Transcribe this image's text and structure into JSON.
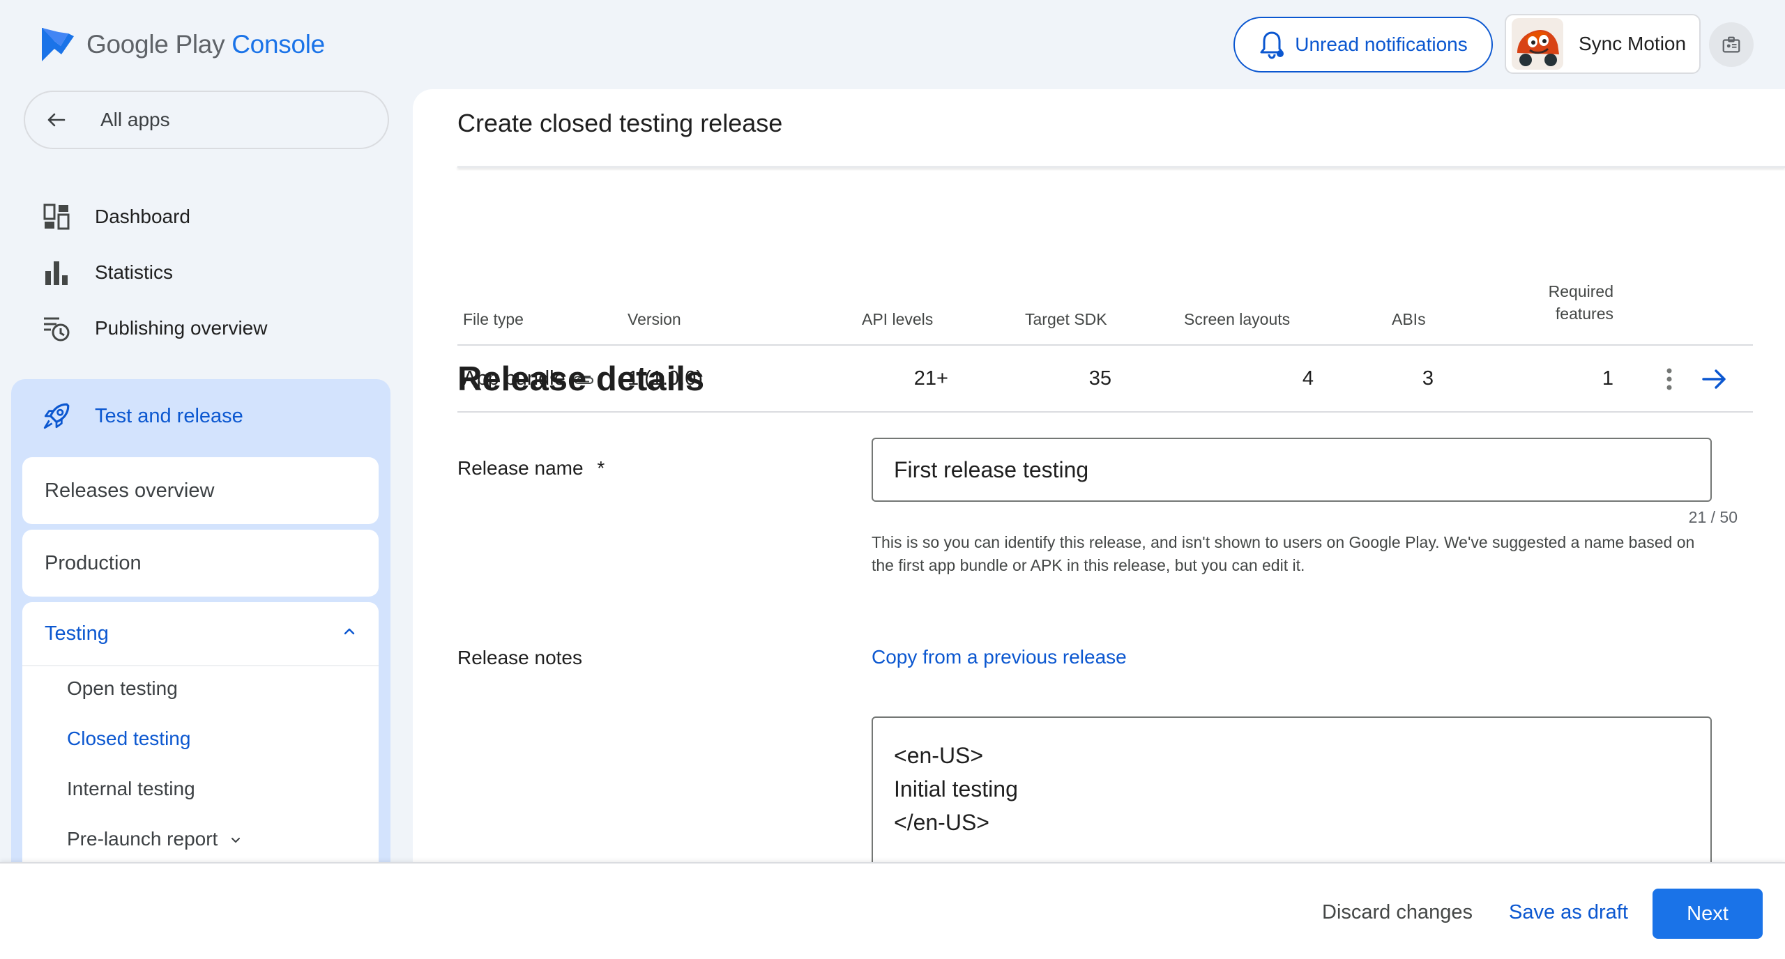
{
  "header": {
    "logo_google_play": "Google Play",
    "logo_console": "Console",
    "notifications_label": "Unread notifications",
    "account_name": "Sync Motion"
  },
  "sidebar": {
    "all_apps": "All apps",
    "items": [
      {
        "label": "Dashboard",
        "icon": "dashboard-icon"
      },
      {
        "label": "Statistics",
        "icon": "bar-chart-icon"
      },
      {
        "label": "Publishing overview",
        "icon": "publishing-history-icon"
      }
    ],
    "test_and_release": {
      "label": "Test and release",
      "icon": "rocket-icon",
      "sub_items": [
        "Releases overview",
        "Production"
      ],
      "testing": {
        "label": "Testing",
        "expanded": true,
        "children": [
          "Open testing",
          "Closed testing",
          "Internal testing",
          "Pre-launch report"
        ],
        "active": "Closed testing"
      }
    }
  },
  "main": {
    "title": "Create closed testing release",
    "table": {
      "headers": {
        "file_type": "File type",
        "version": "Version",
        "api_levels": "API levels",
        "target_sdk": "Target SDK",
        "screen_layouts": "Screen layouts",
        "abis": "ABIs",
        "required_features_line1": "Required",
        "required_features_line2": "features"
      },
      "row": {
        "file_type": "App bundle",
        "version": "1 (1.0.0)",
        "api_levels": "21+",
        "target_sdk": "35",
        "screen_layouts": "4",
        "abis": "3",
        "required_features": "1"
      }
    },
    "release_details": {
      "heading": "Release details",
      "release_name_label": "Release name",
      "required_marker": "*",
      "release_name_value": "First release testing",
      "char_count": "21 / 50",
      "helper_text": "This is so you can identify this release, and isn't shown to users on Google Play. We've suggested a name based on the first app bundle or APK in this release, but you can edit it.",
      "release_notes_label": "Release notes",
      "copy_link": "Copy from a previous release",
      "notes_lines": [
        "<en-US>",
        "Initial testing",
        "</en-US>"
      ]
    }
  },
  "footer": {
    "discard": "Discard changes",
    "save_draft": "Save as draft",
    "next": "Next"
  },
  "colors": {
    "accent": "#0b57d0",
    "primary_button": "#1a73e8",
    "nav_selected_bg": "#d3e3fd",
    "page_bg": "#f0f4f9"
  }
}
